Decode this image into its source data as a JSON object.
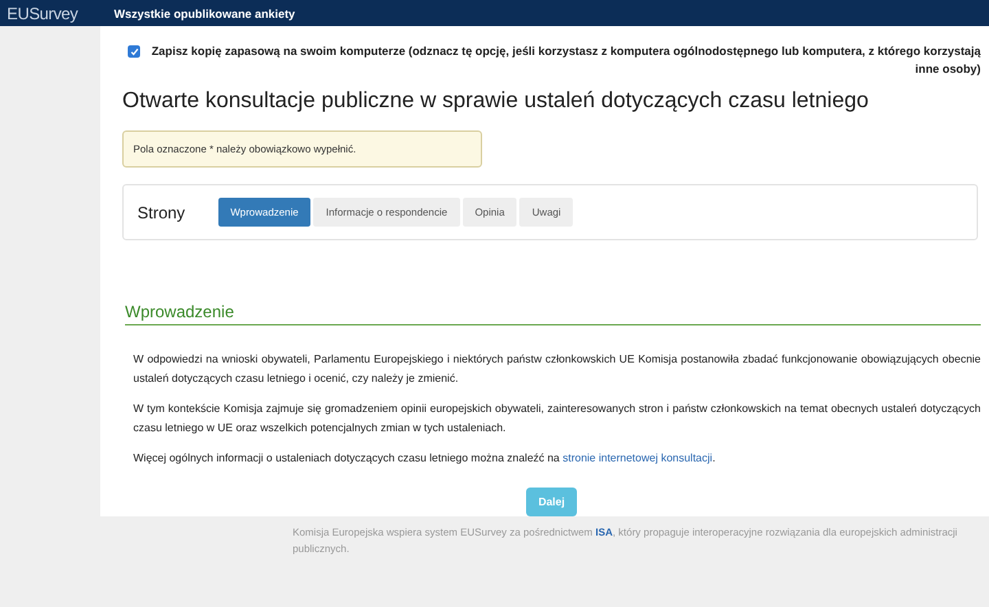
{
  "navbar": {
    "logo": "EUSurvey",
    "link": "Wszystkie opublikowane ankiety"
  },
  "backup": {
    "checked": true,
    "label": "Zapisz kopię zapasową na swoim komputerze (odznacz tę opcję, jeśli korzystasz z komputera ogólnodostępnego lub komputera, z którego korzystają inne osoby)"
  },
  "title": "Otwarte konsultacje publiczne w sprawie ustaleń dotyczących czasu letniego",
  "notice": "Pola oznaczone * należy obowiązkowo wypełnić.",
  "pages": {
    "label": "Strony",
    "tabs": [
      {
        "label": "Wprowadzenie",
        "selected": true
      },
      {
        "label": "Informacje o respondencie",
        "selected": false
      },
      {
        "label": "Opinia",
        "selected": false
      },
      {
        "label": "Uwagi",
        "selected": false
      }
    ]
  },
  "section": {
    "heading": "Wprowadzenie",
    "paragraphs": [
      {
        "text": "W odpowiedzi na wnioski obywateli, Parlamentu Europejskiego i niektórych państw członkowskich UE Komisja postanowiła zbadać funkcjonowanie obowiązujących obecnie ustaleń dotyczących czasu letniego i ocenić, czy należy je zmienić."
      },
      {
        "text": "W tym kontekście Komisja zajmuje się gromadzeniem opinii europejskich obywateli, zainteresowanych stron i państw członkowskich na temat obecnych ustaleń dotyczących czasu letniego w UE oraz wszelkich potencjalnych zmian w tych ustaleniach."
      },
      {
        "text": "Więcej ogólnych informacji o ustaleniach dotyczących czasu letniego można znaleźć na ",
        "link": "stronie internetowej konsultacji",
        "after": "."
      }
    ]
  },
  "next_button": "Dalej",
  "footer": {
    "text": "Komisja Europejska wspiera system EUSurvey za pośrednictwem ",
    "link": "ISA",
    "after": ", który propaguje interoperacyjne rozwiązania dla europejskich administracji publicznych."
  }
}
